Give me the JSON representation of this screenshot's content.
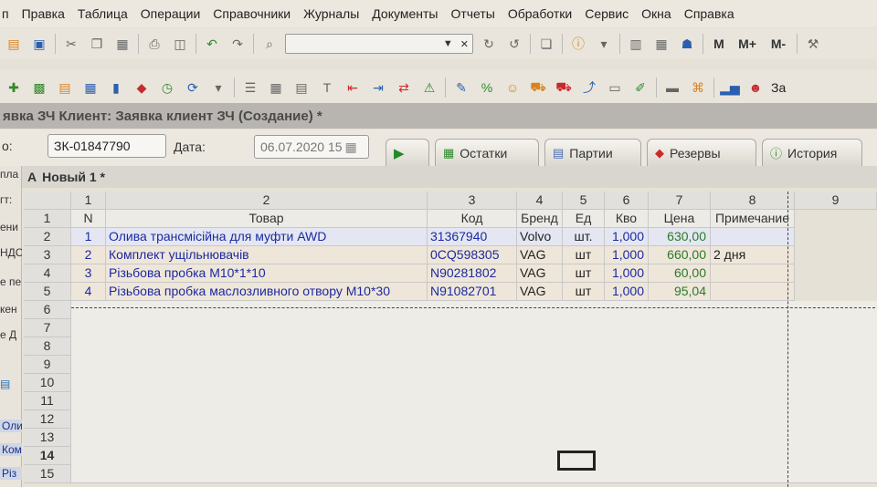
{
  "menu": [
    "п",
    "Правка",
    "Таблица",
    "Операции",
    "Справочники",
    "Журналы",
    "Документы",
    "Отчеты",
    "Обработки",
    "Сервис",
    "Окна",
    "Справка"
  ],
  "toolbar2": {
    "label_m": "М",
    "label_mplus": "М+",
    "label_mminus": "М-"
  },
  "toolbar3": {
    "last_label": "За"
  },
  "window_title": "явка ЗЧ Клиент: Заявка клиент ЗЧ (Создание) *",
  "doc": {
    "number_label": "о:",
    "number_value": "ЗК-01847790",
    "date_label": "Дата:",
    "date_value": "06.07.2020 15"
  },
  "tabs": [
    {
      "label": ""
    },
    {
      "label": "Остатки"
    },
    {
      "label": "Партии"
    },
    {
      "label": "Резервы"
    },
    {
      "label": "История"
    }
  ],
  "left_labels": [
    "пла",
    "гт:",
    "ени",
    "НДС",
    "е пе",
    "кен",
    "е Д",
    "Оли",
    "Ком",
    "Різ"
  ],
  "sheet_title": "Новый 1 *",
  "columns": [
    "1",
    "2",
    "3",
    "4",
    "5",
    "6",
    "7",
    "8",
    "9"
  ],
  "table_header": {
    "n": "N",
    "tovar": "Товар",
    "kod": "Код",
    "brend": "Бренд",
    "ed": "Ед",
    "kvo": "Кво",
    "cena": "Цена",
    "prim": "Примечание"
  },
  "rows": [
    {
      "n": "1",
      "tovar": "Олива трансмісійна для муфти AWD",
      "kod": "31367940",
      "brend": "Volvo",
      "ed": "шт.",
      "kvo": "1,000",
      "cena": "630,00",
      "prim": ""
    },
    {
      "n": "2",
      "tovar": "Комплект ущільнювачів",
      "kod": "0CQ598305",
      "brend": "VAG",
      "ed": "шт",
      "kvo": "1,000",
      "cena": "660,00",
      "prim": "2 дня"
    },
    {
      "n": "3",
      "tovar": "Різьбова пробка M10*1*10",
      "kod": "N90281802",
      "brend": "VAG",
      "ed": "шт",
      "kvo": "1,000",
      "cena": "60,00",
      "prim": ""
    },
    {
      "n": "4",
      "tovar": "Різьбова пробка маслозливного отвору M10*30",
      "kod": "N91082701",
      "brend": "VAG",
      "ed": "шт",
      "kvo": "1,000",
      "cena": "95,04",
      "prim": ""
    }
  ],
  "row_numbers": [
    "1",
    "2",
    "3",
    "4",
    "5",
    "6",
    "7",
    "8",
    "9",
    "10",
    "11",
    "12",
    "13",
    "14",
    "15"
  ]
}
